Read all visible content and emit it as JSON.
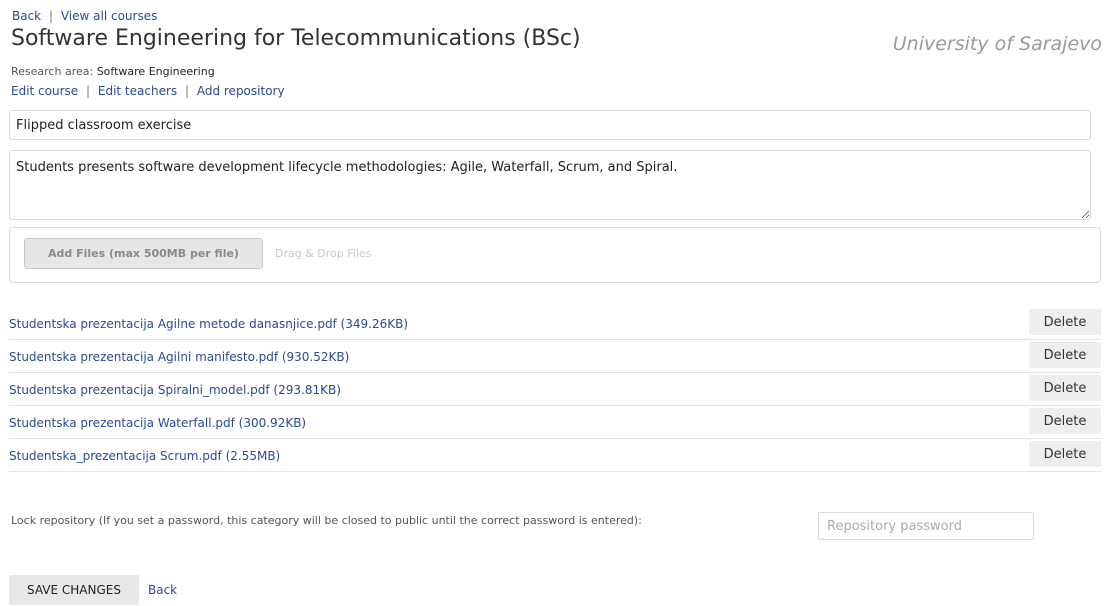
{
  "nav": {
    "back_label": "Back",
    "separator": "|",
    "view_all_label": "View all courses"
  },
  "course": {
    "title": "Software Engineering for Telecommunications (BSc)",
    "university": "University of Sarajevo",
    "research_area_label": "Research area:",
    "research_area_value": "Software Engineering",
    "actions": {
      "edit_course": "Edit course",
      "edit_teachers": "Edit teachers",
      "add_repository": "Add repository",
      "separator": "|"
    }
  },
  "repository": {
    "title_value": "Flipped classroom exercise",
    "description_value": "Students presents software development lifecycle methodologies: Agile, Waterfall, Scrum, and Spiral.",
    "upload": {
      "button_label": "Add Files (max 500MB per file)",
      "drop_hint": "Drag & Drop Files"
    },
    "files": [
      {
        "name": "Studentska prezentacija Agilne metode danasnjice.pdf (349.26KB)",
        "delete_label": "Delete"
      },
      {
        "name": "Studentska prezentacija Agilni manifesto.pdf (930.52KB)",
        "delete_label": "Delete"
      },
      {
        "name": "Studentska prezentacija Spiralni_model.pdf (293.81KB)",
        "delete_label": "Delete"
      },
      {
        "name": "Studentska prezentacija Waterfall.pdf (300.92KB)",
        "delete_label": "Delete"
      },
      {
        "name": "Studentska_prezentacija Scrum.pdf (2.55MB)",
        "delete_label": "Delete"
      }
    ],
    "lock": {
      "label": "Lock repository (If you set a password, this category will be closed to public until the correct password is entered):",
      "password_placeholder": "Repository password",
      "password_value": ""
    }
  },
  "footer": {
    "save_label": "SAVE CHANGES",
    "back_label": "Back"
  },
  "colors": {
    "link": "#2a4a96",
    "university": "#9a9a9a",
    "button_bg": "#eeeeee"
  }
}
